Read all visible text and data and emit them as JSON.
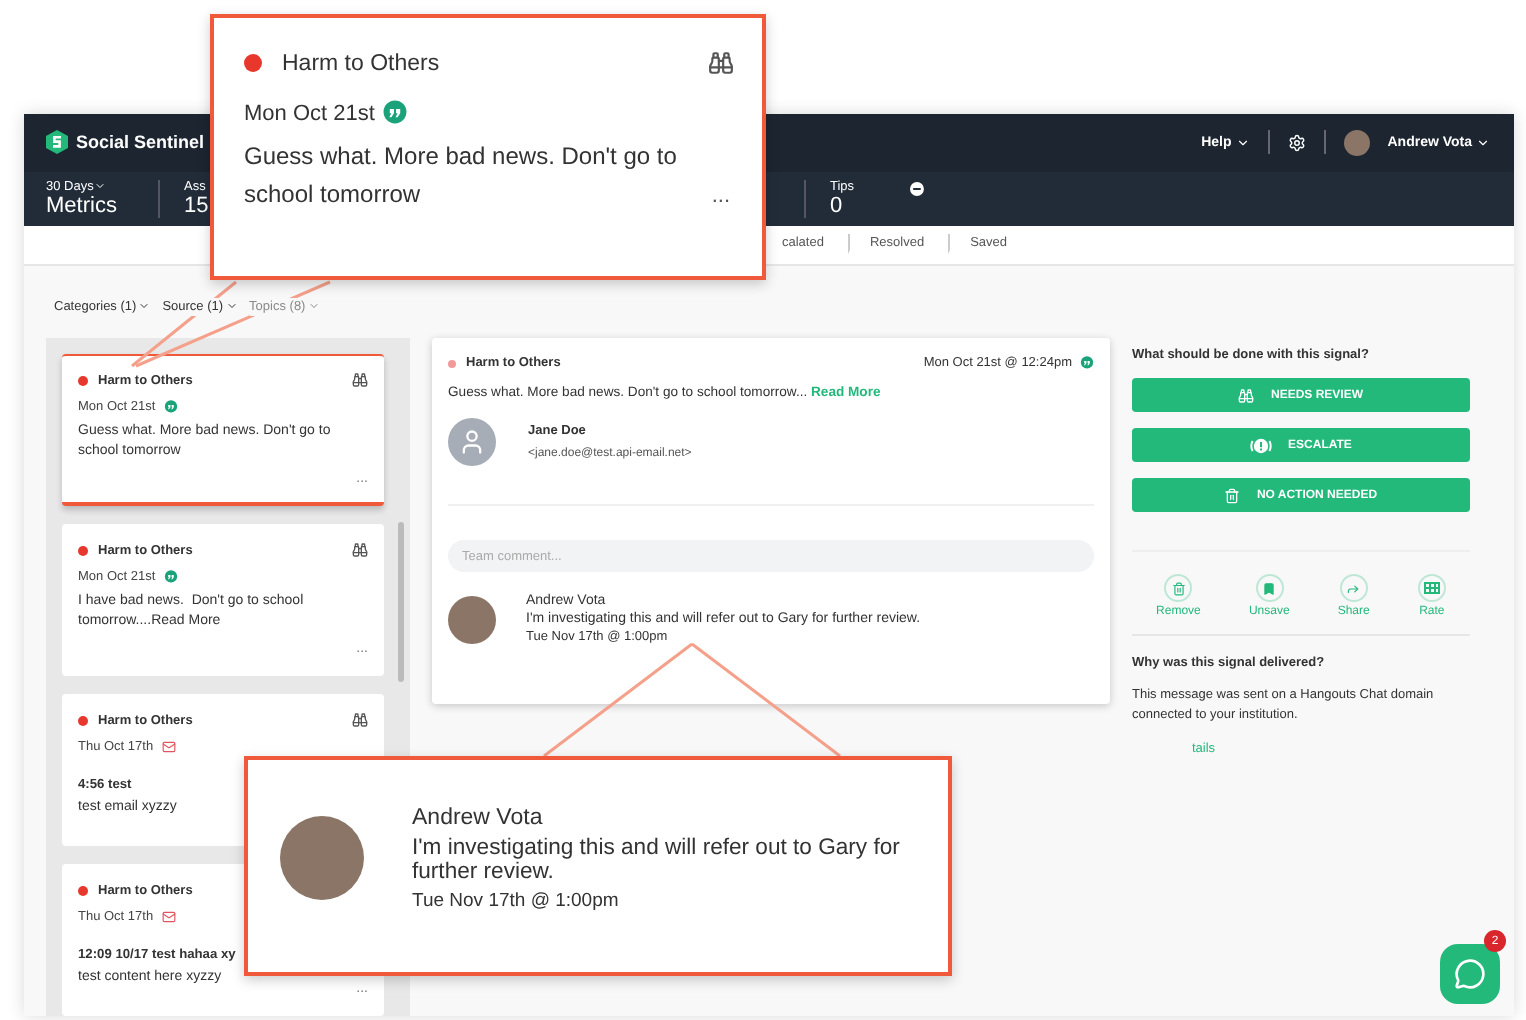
{
  "app": {
    "brand": "Social Sentinel",
    "help": "Help",
    "user": "Andrew Vota"
  },
  "metrics": {
    "period": "30 Days",
    "title": "Metrics",
    "stats": [
      {
        "label": "Ass",
        "value": "15"
      },
      {
        "label": "Tips",
        "value": "0"
      }
    ]
  },
  "tabs": [
    {
      "label": "calated",
      "selected": false
    },
    {
      "label": "Resolved",
      "selected": false
    },
    {
      "label": "Saved",
      "selected": false
    }
  ],
  "filters": [
    {
      "label": "Categories (1)",
      "dimmed": false
    },
    {
      "label": "Source (1)",
      "dimmed": false
    },
    {
      "label": "Topics (8)",
      "dimmed": true
    }
  ],
  "signals": [
    {
      "category": "Harm to Others",
      "color": "#e8372c",
      "date": "Mon Oct 21st",
      "kind": "hangouts",
      "body": "Guess what. More bad news. Don't go to school tomorrow",
      "more": "...",
      "selected": true
    },
    {
      "category": "Harm to Others",
      "color": "#e8372c",
      "date": "Mon Oct 21st",
      "kind": "hangouts",
      "body": "I have bad news.  Don't go to school tomorrow....Read More",
      "more": "...",
      "selected": false
    },
    {
      "category": "Harm to Others",
      "color": "#e8372c",
      "date": "Thu Oct 17th",
      "kind": "email",
      "title": "4:56 test",
      "body": "test email xyzzy",
      "selected": false
    },
    {
      "category": "Harm to Others",
      "color": "#e8372c",
      "date": "Thu Oct 17th",
      "kind": "email",
      "title": "12:09 10/17 test hahaa xy",
      "body": "test content here xyzzy",
      "more": "...",
      "selected": false
    }
  ],
  "detail": {
    "category": "Harm to Others",
    "color": "#f29a9a",
    "date": "Mon Oct 21st @ 12:24pm",
    "body": "Guess what. More bad news. Don't go to school tomorrow...",
    "read_more": "Read More",
    "sender": "Jane Doe",
    "email": "<jane.doe@test.api-email.net>",
    "comment_placeholder": "Team comment...",
    "comment": {
      "author": "Andrew Vota",
      "text": "I'm investigating this and will refer out to Gary for further review.",
      "time": "Tue Nov 17th @ 1:00pm"
    }
  },
  "panel": {
    "question": "What should be done with this signal?",
    "actions": [
      {
        "kind": "review",
        "label": "NEEDS REVIEW"
      },
      {
        "kind": "escalate",
        "label": "ESCALATE"
      },
      {
        "kind": "none",
        "label": "NO ACTION NEEDED"
      }
    ],
    "quick": [
      {
        "kind": "remove",
        "label": "Remove"
      },
      {
        "kind": "unsave",
        "label": "Unsave"
      },
      {
        "kind": "share",
        "label": "Share"
      },
      {
        "kind": "rate",
        "label": "Rate"
      }
    ],
    "why_title": "Why was this signal delivered?",
    "why_text": "This message was sent on a Hangouts Chat domain connected to your institution.",
    "details_link": "tails"
  },
  "callout_top": {
    "category": "Harm to Others",
    "color": "#e8372c",
    "date": "Mon Oct 21st",
    "text": "Guess what. More bad news. Don't go to school tomorrow",
    "more": "..."
  },
  "callout_bottom": {
    "author": "Andrew Vota",
    "text": "I'm investigating this and will refer out to Gary for further review.",
    "time": "Tue Nov 17th @ 1:00pm"
  },
  "chat": {
    "badge": "2"
  }
}
